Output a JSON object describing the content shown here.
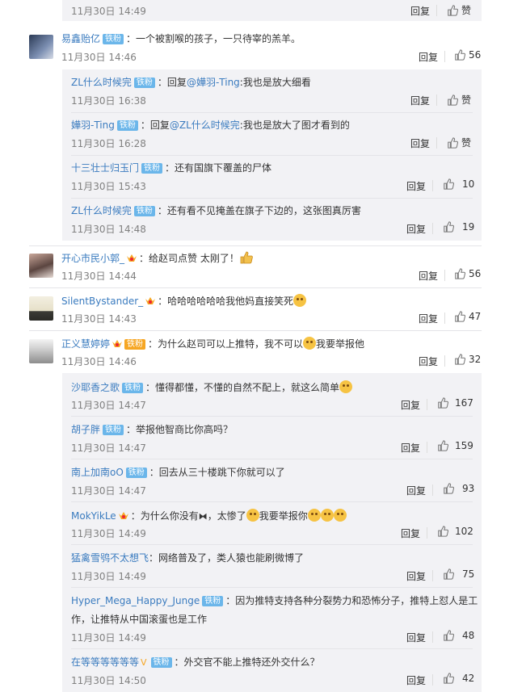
{
  "labels": {
    "reply": "回复",
    "like": "赞"
  },
  "top_row": {
    "time": "11月30日 14:49",
    "likes": "赞"
  },
  "comments": [
    {
      "name": "易鑫贻亿",
      "badge": "铁粉",
      "text": "：一个被割喉的孩子，一只待宰的羔羊。",
      "time": "11月30日 14:46",
      "likes": "56"
    },
    {
      "name": "开心市民小郭_",
      "badge": "",
      "text": "：给赵司点赞 太刚了！",
      "time": "11月30日 14:44",
      "likes": "56"
    },
    {
      "name": "SilentBystander_",
      "badge": "",
      "text": "：哈哈哈哈哈哈我他妈直接笑死",
      "time": "11月30日 14:43",
      "likes": "47"
    },
    {
      "name": "正义慧婷婷",
      "badge": "铁粉",
      "text": "：为什么赵司可以上推特，我不可以",
      "text2": "我要举报他",
      "time": "11月30日 14:46",
      "likes": "32"
    }
  ],
  "replies_a": [
    {
      "name": "ZL什么时候完",
      "badge": "铁粉",
      "pre": "：回复",
      "mention": "@嬅羽-Ting",
      "post": ":我也是放大细看",
      "time": "11月30日 16:38",
      "likes": "赞"
    },
    {
      "name": "嬅羽-Ting",
      "badge": "铁粉",
      "pre": "：回复",
      "mention": "@ZL什么时候完",
      "post": ":我也是放大了图才看到的",
      "time": "11月30日 16:28",
      "likes": "赞"
    },
    {
      "name": "十三壮士归玉门",
      "badge": "铁粉",
      "pre": "：还有国旗下覆盖的尸体",
      "mention": "",
      "post": "",
      "time": "11月30日 15:43",
      "likes": "10"
    },
    {
      "name": "ZL什么时候完",
      "badge": "铁粉",
      "pre": "：还有看不见掩盖在旗子下边的，这张图真厉害",
      "mention": "",
      "post": "",
      "time": "11月30日 14:48",
      "likes": "19"
    }
  ],
  "replies_b": [
    {
      "name": "沙耶香之歌",
      "badge": "铁粉",
      "text": "：懂得都懂，不懂的自然不配上，就这么简单",
      "time": "11月30日 14:47",
      "likes": "167"
    },
    {
      "name": "胡子胖",
      "badge": "铁粉",
      "text": "：举报他智商比你高吗？",
      "time": "11月30日 14:47",
      "likes": "159"
    },
    {
      "name": "南上加南oO",
      "badge": "铁粉",
      "text": "：回去从三十楼跳下你就可以了",
      "time": "11月30日 14:47",
      "likes": "93"
    },
    {
      "name": "MokYikLe",
      "badge": "",
      "text": "：为什么你没有",
      "text2": "，太惨了",
      "text3": "我要举报你",
      "time": "11月30日 14:49",
      "likes": "102"
    },
    {
      "name": "猛禽雪鸮不太想飞",
      "badge": "",
      "text": "：网络普及了，类人猿也能刷微博了",
      "time": "11月30日 14:49",
      "likes": "75"
    },
    {
      "name": "Hyper_Mega_Happy_Junge",
      "badge": "铁粉",
      "text": "：因为推特支持各种分裂势力和恐怖分子，推特上怼人是工",
      "text_cont": "作，让推特从中国滚蛋也是工作",
      "time": "11月30日 14:49",
      "likes": "48"
    },
    {
      "name": "在等等等等等等",
      "badge": "铁粉",
      "text": "：外交官不能上推特还外交什么？",
      "time": "11月30日 14:50",
      "likes": "42"
    }
  ]
}
